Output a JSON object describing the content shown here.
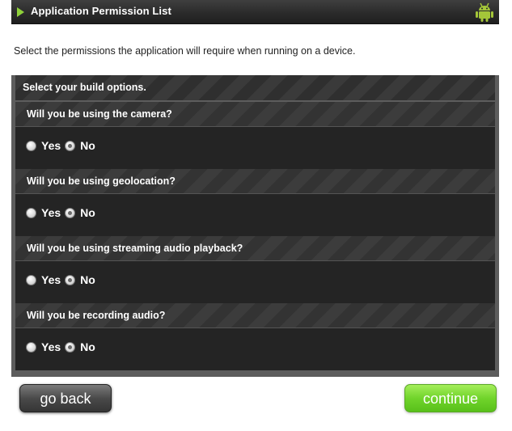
{
  "header": {
    "title": "Application Permission List"
  },
  "description": "Select the permissions the application will require when running on a device.",
  "panel": {
    "heading": "Select your build options.",
    "questions": [
      {
        "label": "Will you be using the camera?",
        "yes": "Yes",
        "no": "No",
        "selected": "No"
      },
      {
        "label": "Will you be using geolocation?",
        "yes": "Yes",
        "no": "No",
        "selected": "No"
      },
      {
        "label": "Will you be using streaming audio playback?",
        "yes": "Yes",
        "no": "No",
        "selected": "No"
      },
      {
        "label": "Will you be recording audio?",
        "yes": "Yes",
        "no": "No",
        "selected": "No"
      }
    ]
  },
  "buttons": {
    "back": "go back",
    "continue": "continue"
  },
  "icons": {
    "title_arrow": "play-arrow-icon",
    "android": "android-icon"
  },
  "colors": {
    "accent_green": "#8fd13a",
    "continue_green": "#71d42b",
    "android_green": "#a4c639"
  }
}
